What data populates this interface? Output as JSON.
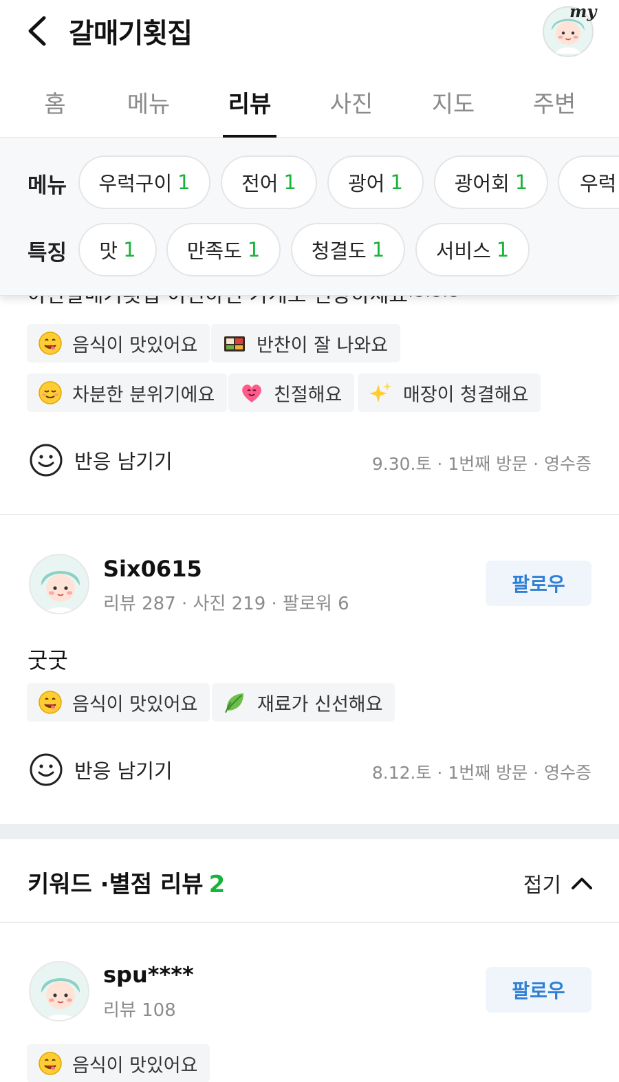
{
  "header": {
    "title": "갈매기횟집",
    "my_label": "my"
  },
  "tabs": [
    {
      "label": "홈"
    },
    {
      "label": "메뉴"
    },
    {
      "label": "리뷰"
    },
    {
      "label": "사진"
    },
    {
      "label": "지도"
    },
    {
      "label": "주변"
    }
  ],
  "active_tab": "리뷰",
  "filters": {
    "menu_label": "메뉴",
    "menu_items": [
      {
        "label": "우럭구이",
        "count": "1"
      },
      {
        "label": "전어",
        "count": "1"
      },
      {
        "label": "광어",
        "count": "1"
      },
      {
        "label": "광어회",
        "count": "1"
      },
      {
        "label": "우럭"
      }
    ],
    "feature_label": "특징",
    "feature_items": [
      {
        "label": "맛",
        "count": "1"
      },
      {
        "label": "만족도",
        "count": "1"
      },
      {
        "label": "청결도",
        "count": "1"
      },
      {
        "label": "서비스",
        "count": "1"
      }
    ]
  },
  "review1": {
    "clipped_text": "아산갈매기횟집 이전하신 가게도 번창하세요~~~",
    "tags": [
      {
        "icon": "yum-face-icon",
        "label": "음식이 맛있어요"
      },
      {
        "icon": "bento-box-icon",
        "label": "반찬이 잘 나와요"
      },
      {
        "icon": "relieved-face-icon",
        "label": "차분한 분위기에요"
      },
      {
        "icon": "heart-face-icon",
        "label": "친절해요"
      },
      {
        "icon": "sparkles-icon",
        "label": "매장이 청결해요"
      }
    ],
    "reaction_label": "반응 남기기",
    "meta": "9.30.토 · 1번째 방문 · 영수증"
  },
  "review2": {
    "username": "Six0615",
    "stats": "리뷰 287 · 사진 219 · 팔로워 6",
    "follow_label": "팔로우",
    "text": "굿굿",
    "tags": [
      {
        "icon": "yum-face-icon",
        "label": "음식이 맛있어요"
      },
      {
        "icon": "leaf-icon",
        "label": "재료가 신선해요"
      }
    ],
    "reaction_label": "반응 남기기",
    "meta": "8.12.토 · 1번째 방문 · 영수증"
  },
  "keyword_section": {
    "title": "키워드 ·별점 리뷰",
    "count": "2",
    "fold_label": "접기"
  },
  "review3": {
    "username": "spu****",
    "stats": "리뷰 108",
    "follow_label": "팔로우",
    "tags": [
      {
        "icon": "yum-face-icon",
        "label": "음식이 맛있어요"
      }
    ]
  },
  "colors": {
    "accent_green": "#19b33a",
    "follow_blue": "#2f7fd6"
  }
}
